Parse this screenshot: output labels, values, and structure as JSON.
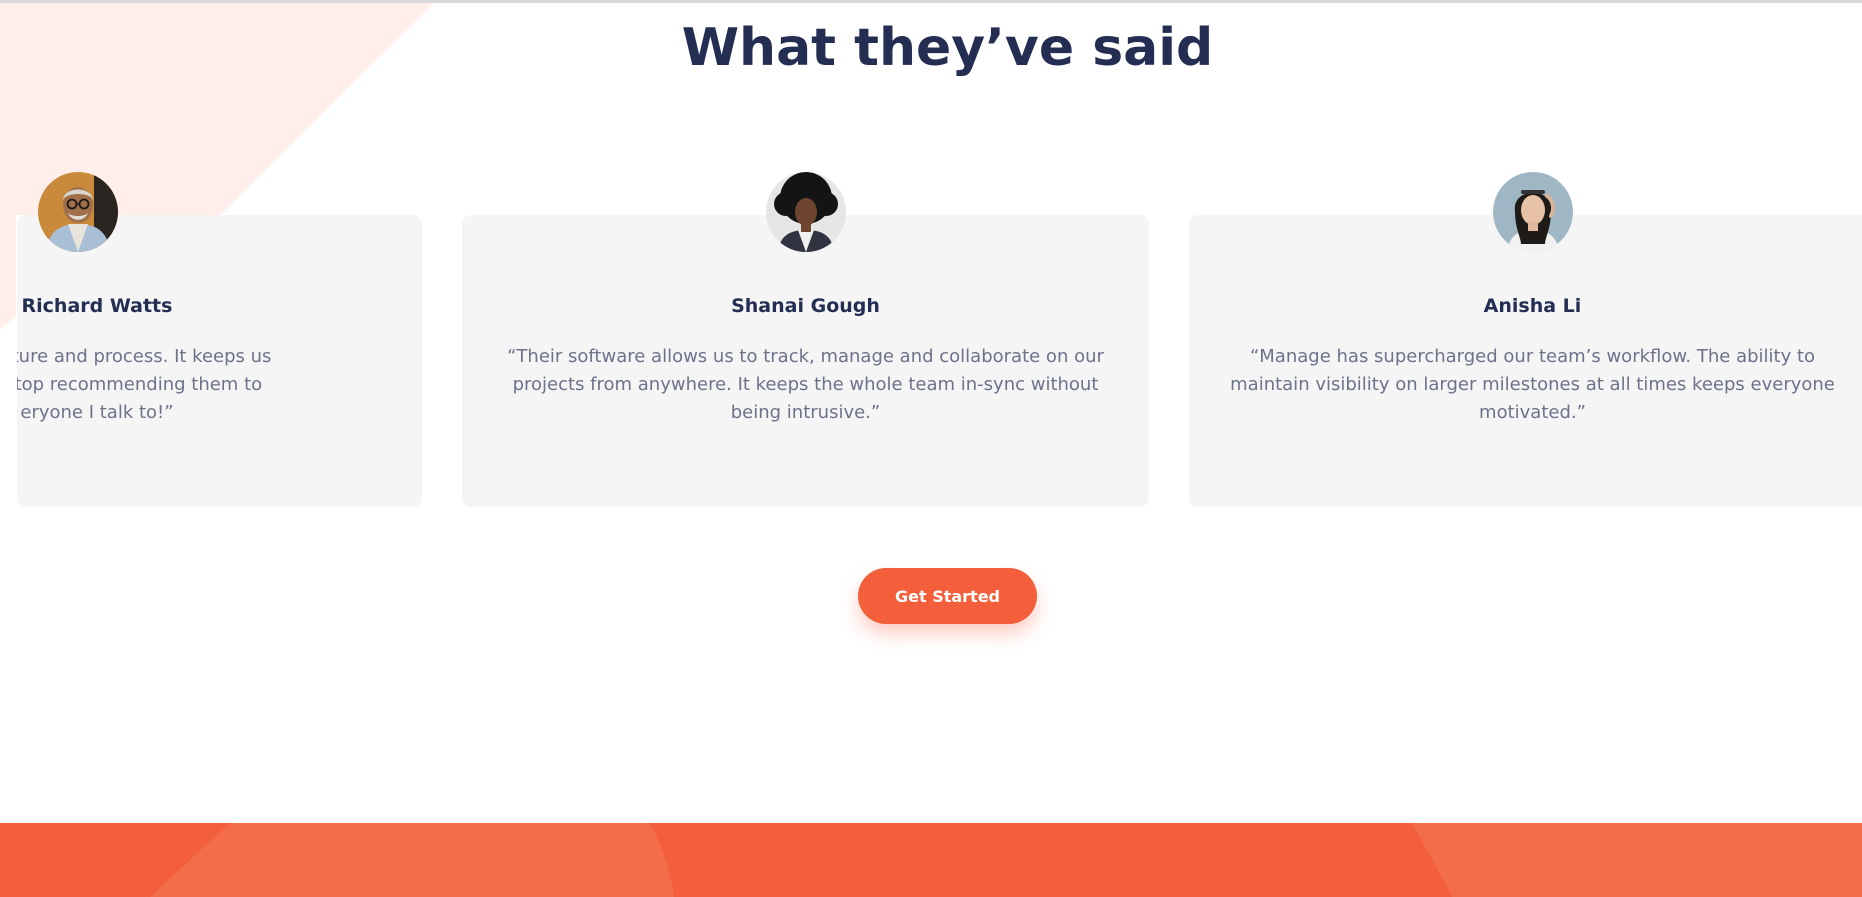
{
  "section": {
    "heading": "What they’ve said"
  },
  "testimonials": [
    {
      "name": "Richard Watts",
      "quote_lines": [
        "vide structure and process. It keeps us",
        ". I can’t stop recommending them to",
        "eryone I talk to!”"
      ]
    },
    {
      "name": "Shanai Gough",
      "quote_lines": [
        "“Their software allows us to track, manage and collaborate on our",
        "projects from anywhere. It keeps the whole team in-sync without",
        "being intrusive.”"
      ]
    },
    {
      "name": "Anisha Li",
      "quote_lines": [
        "“Manage has supercharged our team’s workflow. The ability to",
        "maintain visibility on larger milestones at all times keeps everyone",
        "motivated.”"
      ]
    }
  ],
  "cta": {
    "label": "Get Started"
  },
  "colors": {
    "brand": "#f35e3b",
    "heading": "#242d52",
    "body_text": "#6c7289",
    "card_bg": "#f5f5f5",
    "decor_tint": "#ffeee9"
  }
}
